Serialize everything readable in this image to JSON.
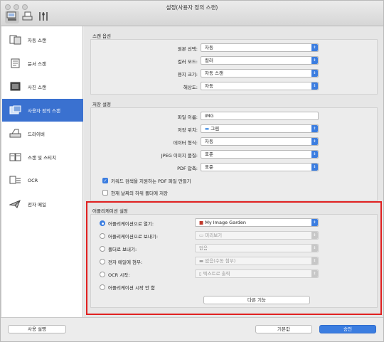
{
  "window": {
    "title": "설정(사용자 정의 스캔)"
  },
  "sidebar": {
    "items": [
      {
        "label": "자동 스캔"
      },
      {
        "label": "문서 스캔"
      },
      {
        "label": "사진 스캔"
      },
      {
        "label": "사용자 정의 스캔"
      },
      {
        "label": "드라이버"
      },
      {
        "label": "스캔 및 스티치"
      },
      {
        "label": "OCR"
      },
      {
        "label": "전자 메일"
      }
    ]
  },
  "scan_options": {
    "title": "스캔 옵션",
    "source": {
      "label": "원본 선택:",
      "value": "자동"
    },
    "color_mode": {
      "label": "컬러 모드:",
      "value": "컬러"
    },
    "paper_size": {
      "label": "용지 크기:",
      "value": "자동 스캔"
    },
    "resolution": {
      "label": "해상도:",
      "value": "자동"
    }
  },
  "save_settings": {
    "title": "저장 설정",
    "file_name": {
      "label": "파일 이름:",
      "value": "IMG"
    },
    "save_in": {
      "label": "저장 위치:",
      "value": "그림"
    },
    "data_format": {
      "label": "데이터 형식:",
      "value": "자동"
    },
    "jpeg_quality": {
      "label": "JPEG 이미지 품질:",
      "value": "표준"
    },
    "pdf_compression": {
      "label": "PDF 압축:",
      "value": "표준"
    },
    "keyword_pdf": {
      "label": "키워드 검색을 지원하는 PDF 파일 만들기"
    },
    "date_subfolder": {
      "label": "현재 날짜의 하위 폴더에 저장"
    }
  },
  "app_settings": {
    "title": "어플리케이션 설정",
    "open_with": {
      "label": "어플리케이션으로 열기:",
      "value": "My Image Garden"
    },
    "send_to_app": {
      "label": "어플리케이션으로 보내기:",
      "value": "미리보기"
    },
    "send_to_folder": {
      "label": "폴더로 보내기:",
      "value": "없음"
    },
    "attach_email": {
      "label": "전자 메일에 첨부:",
      "value": "없음(수동 첨부)"
    },
    "start_ocr": {
      "label": "OCR 시작:",
      "value": "텍스트로 출력"
    },
    "no_app": {
      "label": "어플리케이션 시작 안 함"
    },
    "more_functions": "다른 기능"
  },
  "footer": {
    "instructions": "사용 설명",
    "defaults": "기본값",
    "ok": "승인"
  }
}
